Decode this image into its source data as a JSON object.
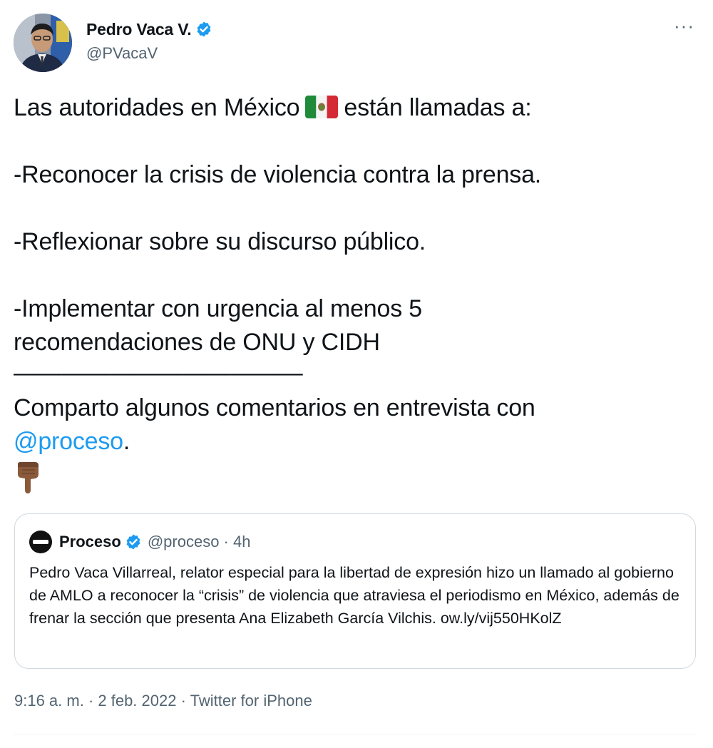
{
  "author": {
    "name": "Pedro Vaca V.",
    "handle": "@PVacaV",
    "verified": true
  },
  "more_label": "···",
  "tweet": {
    "line1_before": "Las autoridades en México",
    "line1_emoji": "mexico-flag",
    "line1_after": "están llamadas a:",
    "point1": "-Reconocer la crisis de violencia contra la prensa.",
    "point2": "-Reflexionar sobre su discurso público.",
    "point3_line1": "-Implementar con urgencia al menos 5",
    "point3_line2": "recomendaciones de ONU y CIDH",
    "separator": "————————————",
    "closing_before": "Comparto algunos comentarios en entrevista con",
    "closing_mention": "@proceso",
    "closing_after": ".",
    "emoji_end": "backhand-index-pointing-down"
  },
  "quoted": {
    "name": "Proceso",
    "verified": true,
    "handle_time": "@proceso · 4h",
    "text": "Pedro Vaca Villarreal, relator especial para la libertad de expresión hizo un llamado al gobierno de AMLO a reconocer la “crisis” de violencia que atraviesa el periodismo en México, además de frenar la sección que presenta Ana Elizabeth García Vilchis. ow.ly/vij550HKolZ"
  },
  "meta": {
    "time": "9:16 a. m.",
    "date": "2 feb. 2022",
    "source": "Twitter for iPhone",
    "text": "9:16 a. m. · 2 feb. 2022 · Twitter for iPhone"
  },
  "colors": {
    "accent": "#1d9bf0",
    "text": "#0f1419",
    "secondary": "#536471",
    "border": "#cfd9de"
  }
}
